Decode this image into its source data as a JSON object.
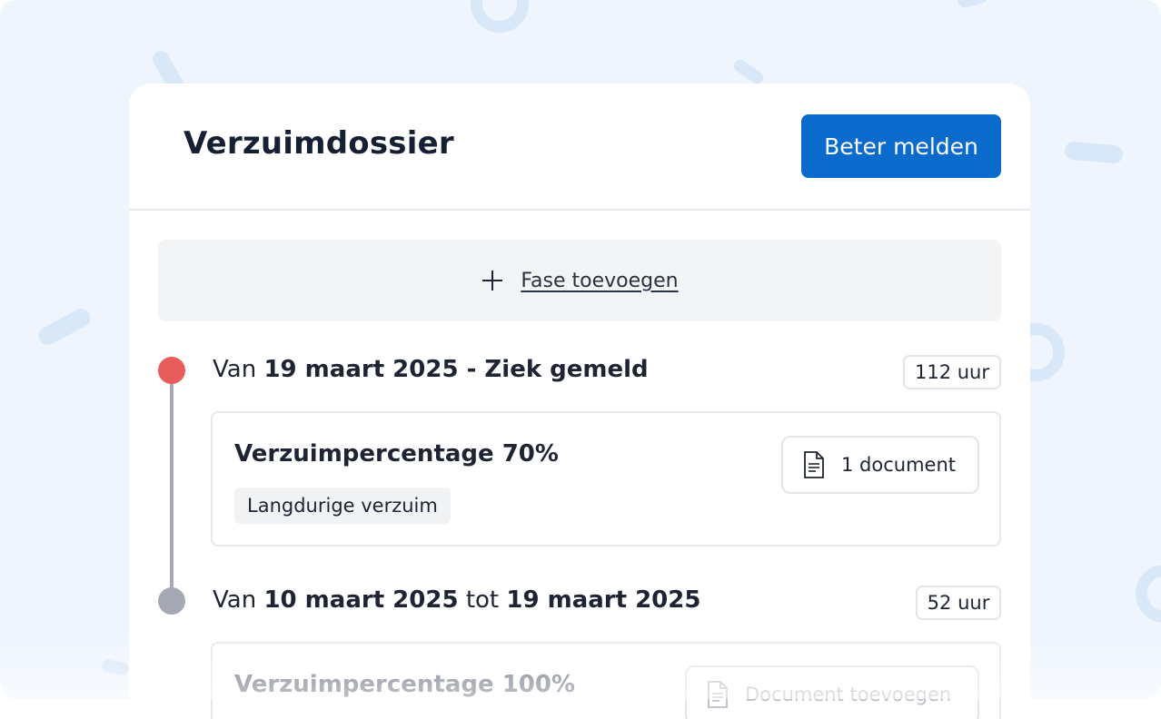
{
  "header": {
    "title": "Verzuimdossier",
    "primary_button": "Beter melden"
  },
  "add_phase": {
    "icon": "plus-icon",
    "label": "Fase toevoegen"
  },
  "phases": [
    {
      "status_color": "#e85c5c",
      "prefix": "Van",
      "title": "19 maart 2025 - Ziek gemeld",
      "hours": "112 uur",
      "item": {
        "title": "Verzuimpercentage 70%",
        "tag": "Langdurige verzuim",
        "document_button": "1 document",
        "document_icon": "document-icon"
      }
    },
    {
      "status_color": "#a5a9b3",
      "prefix": "Van",
      "start": "10 maart 2025",
      "connector": "tot",
      "end": "19 maart 2025",
      "hours": "52 uur",
      "item": {
        "title": "Verzuimpercentage 100%",
        "document_button": "Document toevoegen",
        "document_icon": "document-icon"
      }
    }
  ],
  "colors": {
    "primary": "#0a6bcc",
    "background": "#eef5fd",
    "decor": "#d9e8f8"
  }
}
